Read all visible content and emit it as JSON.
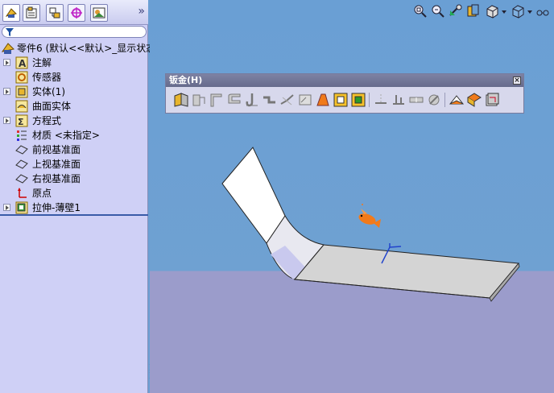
{
  "featuremanager": {
    "tabs": [
      "feature-manager-tab",
      "property-manager-tab",
      "configuration-manager-tab",
      "dimxpert-tab",
      "display-manager-tab"
    ],
    "expand_label": "»",
    "filter_icon": "filter-icon",
    "tree": [
      {
        "label": "零件6 (默认<<默认>_显示状态",
        "icon": "part-icon",
        "expandable": false
      },
      {
        "label": "注解",
        "icon": "annotations-icon",
        "expandable": true
      },
      {
        "label": "传感器",
        "icon": "sensors-icon",
        "expandable": false
      },
      {
        "label": "实体(1)",
        "icon": "solid-bodies-icon",
        "expandable": true
      },
      {
        "label": "曲面实体",
        "icon": "surface-bodies-icon",
        "expandable": false
      },
      {
        "label": "方程式",
        "icon": "equations-icon",
        "expandable": true
      },
      {
        "label": "材质 <未指定>",
        "icon": "material-icon",
        "expandable": false
      },
      {
        "label": "前视基准面",
        "icon": "plane-icon",
        "expandable": false
      },
      {
        "label": "上视基准面",
        "icon": "plane-icon",
        "expandable": false
      },
      {
        "label": "右视基准面",
        "icon": "plane-icon",
        "expandable": false
      },
      {
        "label": "原点",
        "icon": "origin-icon",
        "expandable": false
      },
      {
        "label": "拉伸-薄壁1",
        "icon": "extrude-thin-icon",
        "expandable": true
      }
    ]
  },
  "sheetmetal_toolbar": {
    "title": "钣金(H)",
    "close_label": "×",
    "buttons": [
      "base-flange-icon",
      "convert-to-sheetmetal-icon",
      "edge-flange-icon",
      "miter-flange-icon",
      "hem-icon",
      "jog-icon",
      "sketched-bend-icon",
      "cross-break-icon",
      "lofted-bend-icon",
      "closed-corner-icon",
      "welded-corner-icon",
      "insert-bends-icon",
      "no-bends-icon",
      "rip-icon",
      "unfold-icon",
      "fold-icon",
      "flatten-icon",
      "forming-tool-icon",
      "corner-relief-icon",
      "break-corner-icon"
    ]
  },
  "view_toolbar": [
    "zoom-to-fit-icon",
    "zoom-area-icon",
    "previous-view-icon",
    "section-view-icon",
    "view-orientation-icon",
    "display-style-icon",
    "hide-show-icon"
  ],
  "colors": {
    "viewport_top": "#6a9fd4",
    "viewport_floor": "#9b9ccb",
    "panel": "#cfd0f6",
    "part_face": "#ffffff",
    "part_shade": "#d0d0d0"
  }
}
